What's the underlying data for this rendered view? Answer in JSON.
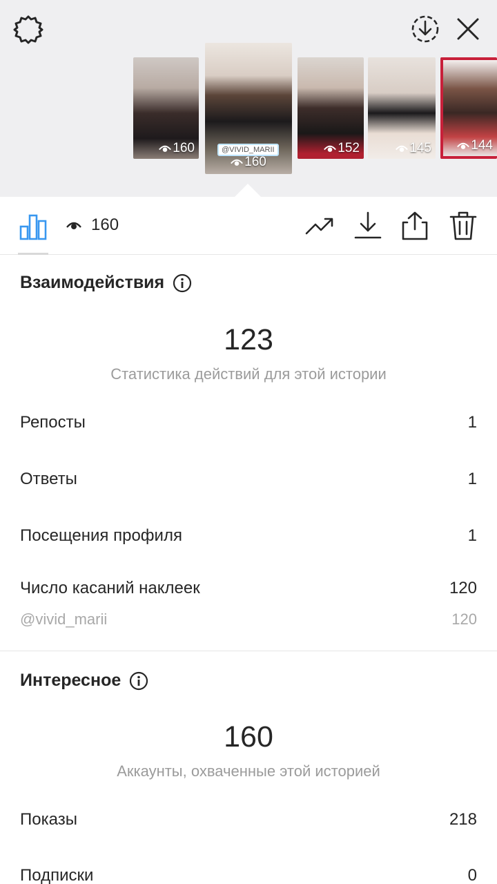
{
  "top": {
    "thumbnails": [
      {
        "views": "160"
      },
      {
        "views": "160",
        "tag": "@VIVID_MARII"
      },
      {
        "views": "152"
      },
      {
        "views": "145"
      },
      {
        "views": "144"
      }
    ]
  },
  "toolbar": {
    "viewers_count": "160"
  },
  "interactions": {
    "title": "Взаимодействия",
    "total": "123",
    "caption": "Статистика действий для этой истории",
    "rows": [
      {
        "label": "Репосты",
        "value": "1"
      },
      {
        "label": "Ответы",
        "value": "1"
      },
      {
        "label": "Посещения профиля",
        "value": "1"
      },
      {
        "label": "Число касаний наклеек",
        "value": "120"
      }
    ],
    "sub_row": {
      "label": "@vivid_marii",
      "value": "120"
    }
  },
  "discovery": {
    "title": "Интересное",
    "total": "160",
    "caption": "Аккаунты, охваченные этой историей",
    "rows": [
      {
        "label": "Показы",
        "value": "218"
      },
      {
        "label": "Подписки",
        "value": "0"
      }
    ]
  },
  "colors": {
    "accent_blue": "#3897f0",
    "text": "#262626",
    "muted": "#9b9b9b",
    "top_bg": "#efeff1"
  },
  "icons": [
    "settings-icon",
    "save-all-icon",
    "close-icon",
    "eye-icon",
    "insights-bar-chart-icon",
    "promote-trend-icon",
    "download-icon",
    "share-icon",
    "delete-icon",
    "info-icon"
  ]
}
